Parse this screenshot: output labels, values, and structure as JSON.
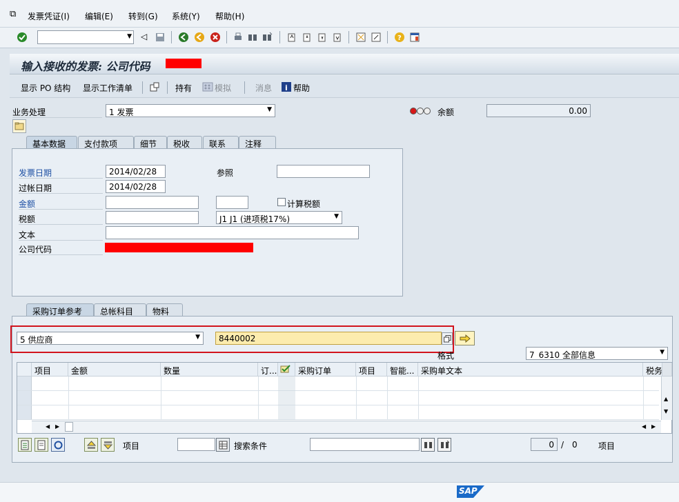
{
  "menu": {
    "items": [
      "发票凭证(I)",
      "编辑(E)",
      "转到(G)",
      "系统(Y)",
      "帮助(H)"
    ]
  },
  "title": "输入接收的发票: 公司代码",
  "appbar": {
    "show_po": "显示 PO 结构",
    "worklist": "显示工作清单",
    "hold": "持有",
    "simulate": "模拟",
    "message": "消息",
    "help": "帮助"
  },
  "header": {
    "transaction_label": "业务处理",
    "transaction_value": "1 发票",
    "balance_label": "余额",
    "balance_value": "0.00"
  },
  "tabs": [
    "基本数据",
    "支付款项",
    "细节",
    "税收",
    "联系",
    "注释"
  ],
  "basic": {
    "invoice_date_label": "发票日期",
    "invoice_date": "2014/02/28",
    "reference_label": "参照",
    "reference": "",
    "posting_date_label": "过帐日期",
    "posting_date": "2014/02/28",
    "amount_label": "金额",
    "amount": "",
    "currency": "",
    "calc_tax_label": "计算税额",
    "tax_label": "税额",
    "tax": "",
    "tax_code": "J1 J1 (进项税17%)",
    "text_label": "文本",
    "text": "",
    "company_label": "公司代码"
  },
  "lower_tabs": [
    "采购订单参考",
    "总帐科目",
    "物料"
  ],
  "po_ref": {
    "ref_type": "5 供应商",
    "vendor": "8440002",
    "layout_label": "格式",
    "layout_value": "7_6310 全部信息"
  },
  "grid": {
    "columns": [
      "项目",
      "金额",
      "数量",
      "订...",
      "",
      "采购订单",
      "项目",
      "智能...",
      "采购单文本",
      "税务"
    ]
  },
  "bottom": {
    "item_label": "项目",
    "item_value": "",
    "search_label": "搜索条件",
    "search_value": "",
    "count": "0",
    "slash": "/",
    "total": "0",
    "item_label2": "项目"
  },
  "brand": "SAP",
  "colors": {
    "highlight_field": "#fcecae",
    "redbox": "#d2141d",
    "redact": "#ff0000"
  }
}
